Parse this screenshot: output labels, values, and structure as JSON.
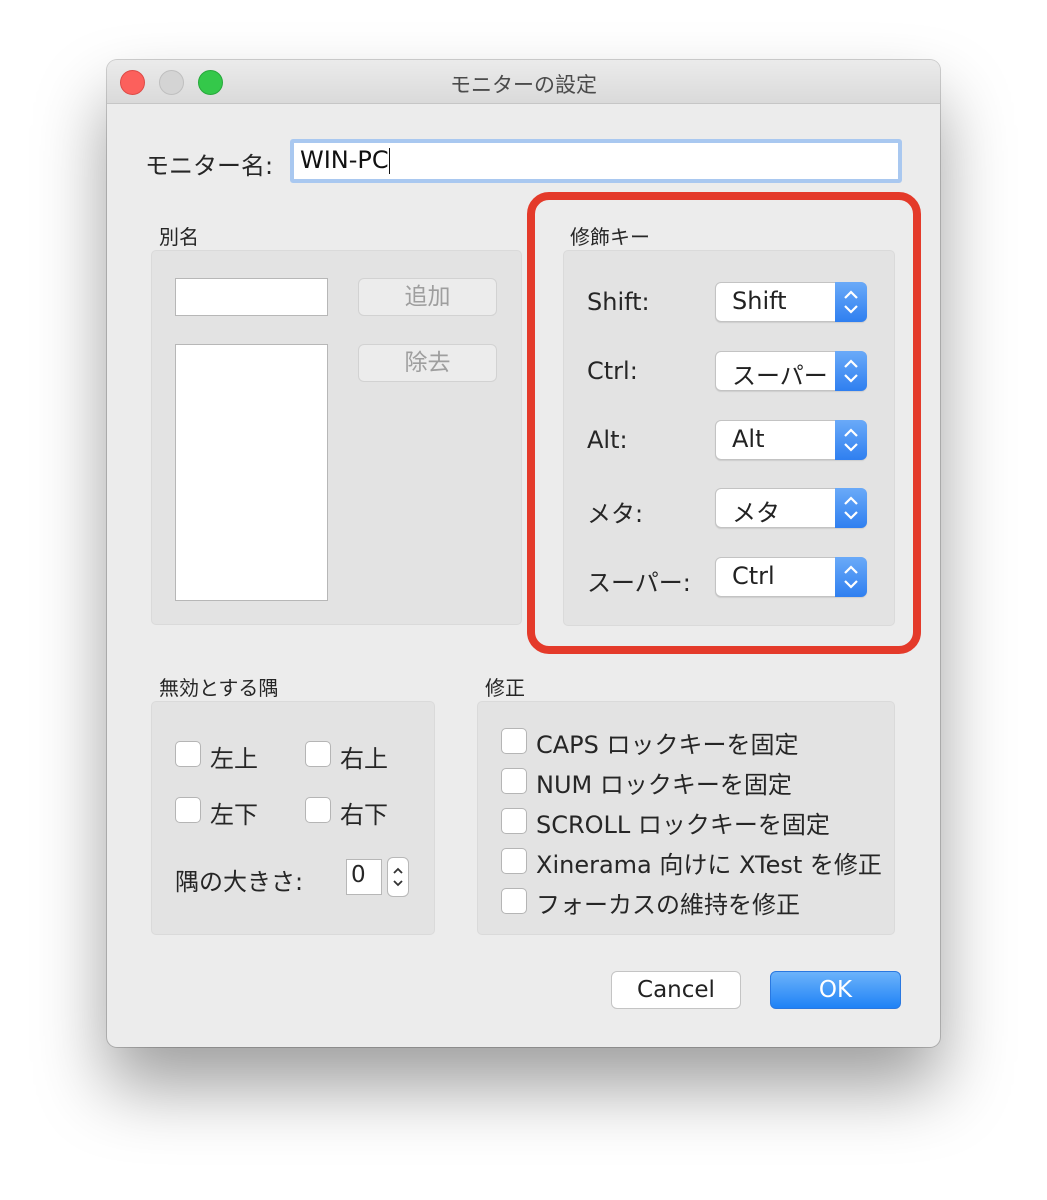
{
  "window": {
    "title": "モニターの設定"
  },
  "monitor_name": {
    "label": "モニター名:",
    "value": "WIN-PC"
  },
  "aliases": {
    "section_label": "別名",
    "add_button": "追加",
    "remove_button": "除去"
  },
  "modifier_keys": {
    "section_label": "修飾キー",
    "rows": [
      {
        "label": "Shift:",
        "value": "Shift"
      },
      {
        "label": "Ctrl:",
        "value": "スーパー"
      },
      {
        "label": "Alt:",
        "value": "Alt"
      },
      {
        "label": "メタ:",
        "value": "メタ"
      },
      {
        "label": "スーパー:",
        "value": "Ctrl"
      }
    ]
  },
  "dead_corners": {
    "section_label": "無効とする隅",
    "top_left": "左上",
    "top_right": "右上",
    "bottom_left": "左下",
    "bottom_right": "右下",
    "corner_size_label": "隅の大きさ:",
    "corner_size_value": "0"
  },
  "fixes": {
    "section_label": "修正",
    "options": [
      "CAPS ロックキーを固定",
      "NUM ロックキーを固定",
      "SCROLL ロックキーを固定",
      "Xinerama 向けに XTest を修正",
      "フォーカスの維持を修正"
    ]
  },
  "buttons": {
    "cancel": "Cancel",
    "ok": "OK"
  },
  "colors": {
    "highlight_border": "#e43a2a",
    "accent_blue": "#1f82f6"
  }
}
